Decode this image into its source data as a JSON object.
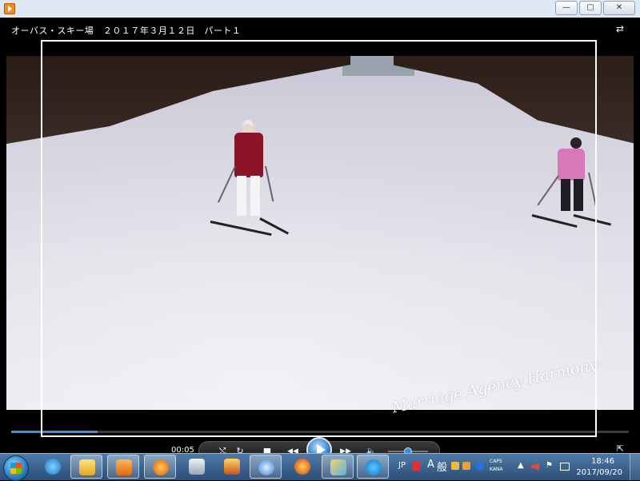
{
  "window": {
    "minimize_glyph": "—",
    "maximize_glyph": "▢",
    "close_glyph": "✕"
  },
  "player": {
    "title": "オーバス・スキー場　２０１７年３月１２日　パート１",
    "elapsed": "00:05",
    "progress": 0.14,
    "volume": 0.4,
    "watermark": "Marriage Agency Harmony"
  },
  "controls": {
    "shuffle_glyph": "⤭",
    "repeat_glyph": "↻",
    "stop_glyph": "■",
    "prev_glyph": "◀◀",
    "next_glyph": "▶▶",
    "volume_glyph": "🔈",
    "switch_glyph": "⇄",
    "fullscreen_glyph": "⇱"
  },
  "taskbar": {
    "icons": [
      "windows-start-icon",
      "internet-explorer-icon",
      "file-explorer-icon",
      "media-player-icon",
      "firefox-icon",
      "camera-icon",
      "winamp-icon",
      "itunes-icon",
      "headphones-icon",
      "paint-icon",
      "skype-icon"
    ],
    "tray": {
      "language": "JP",
      "ime_mode": "A",
      "ime_kanji": "般",
      "caps": "CAPS",
      "kana": "KANA",
      "time": "18:46",
      "date": "2017/09/20"
    }
  },
  "colors": {
    "accent": "#3d8de0",
    "taskbar": "#2b4f78"
  }
}
